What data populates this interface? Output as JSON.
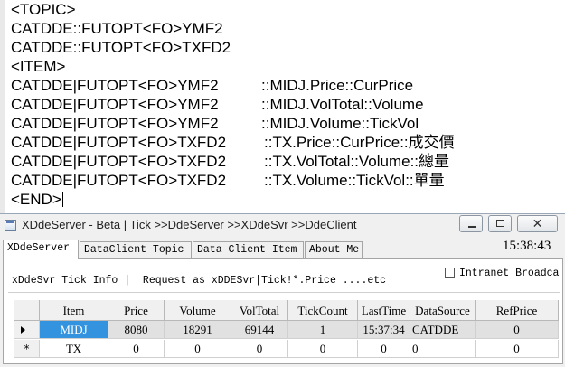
{
  "editor": {
    "lines": [
      {
        "left": "<TOPIC>",
        "right": ""
      },
      {
        "left": "CATDDE::FUTOPT<FO>YMF2",
        "right": ""
      },
      {
        "left": "CATDDE::FUTOPT<FO>TXFD2",
        "right": ""
      },
      {
        "left": "<ITEM>",
        "right": ""
      },
      {
        "left": "CATDDE|FUTOPT<FO>YMF2",
        "right": "::MIDJ.Price::CurPrice"
      },
      {
        "left": "CATDDE|FUTOPT<FO>YMF2",
        "right": "::MIDJ.VolTotal::Volume"
      },
      {
        "left": "CATDDE|FUTOPT<FO>YMF2",
        "right": "::MIDJ.Volume::TickVol"
      },
      {
        "left": "CATDDE|FUTOPT<FO>TXFD2",
        "right": "::TX.Price::CurPrice::成交價"
      },
      {
        "left": "CATDDE|FUTOPT<FO>TXFD2",
        "right": "::TX.VolTotal::Volume::總量"
      },
      {
        "left": "CATDDE|FUTOPT<FO>TXFD2",
        "right": "::TX.Volume::TickVol::單量"
      },
      {
        "left": "<END>",
        "right": ""
      }
    ]
  },
  "window": {
    "title": "XDdeServer - Beta | Tick >>DdeServer >>XDdeSvr >>DdeClient",
    "close_glyph": "✕",
    "tabs": [
      {
        "label": "XDdeServer"
      },
      {
        "label": "DataClient Topic"
      },
      {
        "label": "Data Client Item"
      },
      {
        "label": "About Me"
      }
    ],
    "clock": "15:38:43",
    "tick_info": "xDdeSvr Tick Info |  Request as xDDESvr|Tick!*.Price ....etc",
    "intranet_label": "Intranet Broadca"
  },
  "grid": {
    "columns": [
      "Item",
      "Price",
      "Volume",
      "VolTotal",
      "TickCount",
      "LastTime",
      "DataSource",
      "RefPrice"
    ],
    "rows": [
      {
        "marker": "arrow",
        "cells": [
          "MIDJ",
          "8080",
          "18291",
          "69144",
          "1",
          "15:37:34",
          "CATDDE",
          "0"
        ]
      },
      {
        "marker": "*",
        "cells": [
          "TX",
          "0",
          "0",
          "0",
          "0",
          "0",
          "0",
          "0"
        ]
      }
    ]
  }
}
